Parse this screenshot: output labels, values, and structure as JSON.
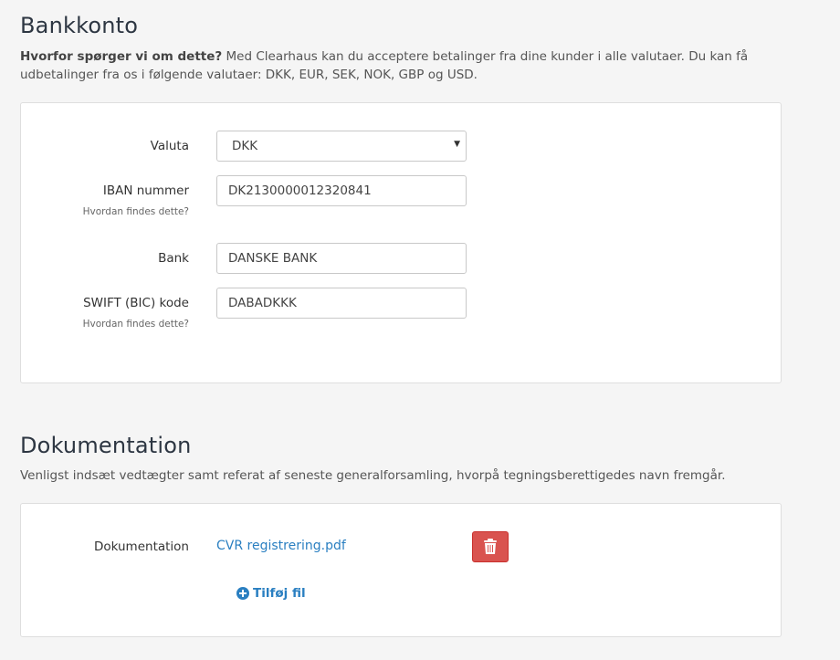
{
  "bank": {
    "title": "Bankkonto",
    "desc_bold": "Hvorfor spørger vi om dette?",
    "desc_text": " Med Clearhaus kan du acceptere betalinger fra dine kunder i alle valutaer. Du kan få udbetalinger fra os i følgende valutaer: DKK, EUR, SEK, NOK, GBP og USD.",
    "currency_label": "Valuta",
    "currency_value": "DKK",
    "iban_label": "IBAN nummer",
    "iban_help": "Hvordan findes dette?",
    "iban_value": "DK2130000012320841",
    "bank_label": "Bank",
    "bank_value": "DANSKE BANK",
    "swift_label": "SWIFT (BIC) kode",
    "swift_help": "Hvordan findes dette?",
    "swift_value": "DABADKKK"
  },
  "docs": {
    "title": "Dokumentation",
    "desc": "Venligst indsæt vedtægter samt referat af seneste generalforsamling, hvorpå tegningsberettigedes navn fremgår.",
    "doc_label": "Dokumentation",
    "file_name": "CVR registrering.pdf",
    "add_file_label": "Tilføj fil"
  },
  "colors": {
    "accent": "#2a7fc1",
    "danger": "#d9534f",
    "background": "#f5f5f5"
  }
}
